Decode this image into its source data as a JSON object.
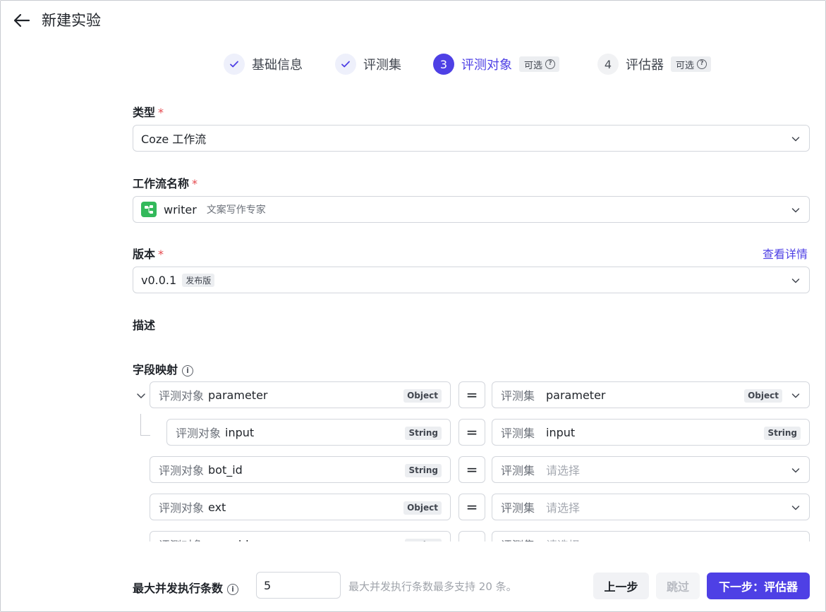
{
  "header": {
    "title": "新建实验"
  },
  "steps": [
    {
      "label": "基础信息",
      "state": "done",
      "number": ""
    },
    {
      "label": "评测集",
      "state": "done",
      "number": ""
    },
    {
      "label": "评测对象",
      "state": "active",
      "number": "3",
      "optional_tag": "可选"
    },
    {
      "label": "评估器",
      "state": "todo",
      "number": "4",
      "optional_tag": "可选"
    }
  ],
  "form": {
    "type": {
      "label": "类型",
      "required_mark": "*",
      "value": "Coze 工作流"
    },
    "workflow": {
      "label": "工作流名称",
      "required_mark": "*",
      "value": "writer",
      "sub": "文案写作专家"
    },
    "version": {
      "label": "版本",
      "required_mark": "*",
      "value": "v0.0.1",
      "tag": "发布版",
      "link": "查看详情"
    },
    "description": {
      "label": "描述"
    },
    "mapping": {
      "label": "字段映射",
      "target_prefix": "评测对象",
      "dataset_prefix": "评测集",
      "eq": "=",
      "placeholder": "请选择",
      "rows": [
        {
          "target": "parameter",
          "target_type": "Object",
          "dataset": "parameter",
          "dataset_type": "Object"
        },
        {
          "target": "input",
          "target_type": "String",
          "dataset": "input",
          "dataset_type": "String"
        },
        {
          "target": "bot_id",
          "target_type": "String",
          "dataset": ""
        },
        {
          "target": "ext",
          "target_type": "Object",
          "dataset": ""
        },
        {
          "target": "user_id",
          "target_type": "String",
          "dataset": ""
        }
      ]
    }
  },
  "footer": {
    "concurrency_label": "最大并发执行条数",
    "concurrency_value": "5",
    "concurrency_hint": "最大并发执行条数最多支持 20 条。",
    "prev_label": "上一步",
    "skip_label": "跳过",
    "next_label": "下一步：评估器"
  },
  "colors": {
    "accent": "#4e40e5",
    "required": "#e5484d",
    "workflow_icon": "#33b95b"
  }
}
